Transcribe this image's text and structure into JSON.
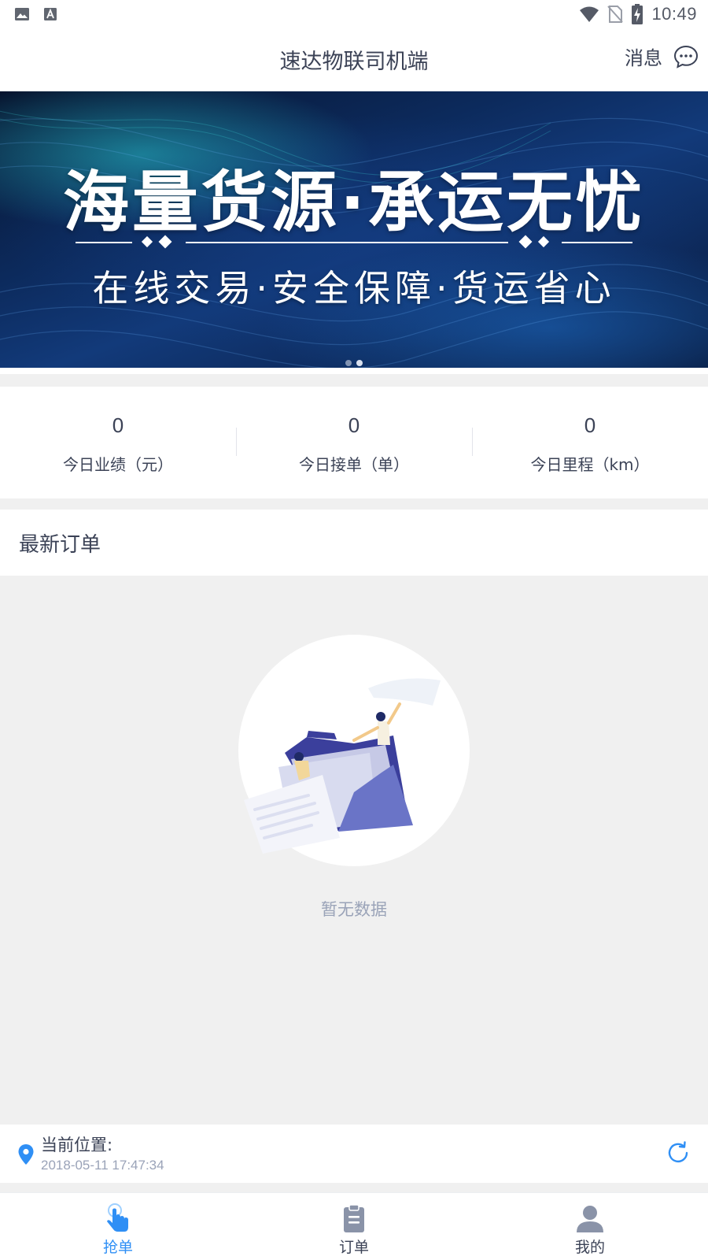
{
  "status_bar": {
    "time": "10:49",
    "left_icons": [
      "image-icon",
      "font-icon"
    ],
    "right_icons": [
      "wifi-icon",
      "no-sim-icon",
      "battery-charging-icon"
    ]
  },
  "header": {
    "title": "速达物联司机端",
    "message_label": "消息",
    "message_icon": "chat-bubble-icon"
  },
  "banner": {
    "headline": "海量货源·承运无忧",
    "subline": "在线交易·安全保障·货运省心",
    "active_slide": 1,
    "slide_count": 2
  },
  "stats": [
    {
      "value": "0",
      "label": "今日业绩（元）"
    },
    {
      "value": "0",
      "label": "今日接单（单）"
    },
    {
      "value": "0",
      "label": "今日里程（km）"
    }
  ],
  "orders": {
    "title": "最新订单",
    "empty_text": "暂无数据"
  },
  "location": {
    "label": "当前位置:",
    "timestamp": "2018-05-11 17:47:34",
    "icon": "location-pin-icon",
    "refresh_icon": "refresh-icon"
  },
  "bottom_nav": {
    "items": [
      {
        "label": "抢单",
        "icon": "tap-hand-icon",
        "active": true
      },
      {
        "label": "订单",
        "icon": "clipboard-icon",
        "active": false
      },
      {
        "label": "我的",
        "icon": "user-icon",
        "active": false
      }
    ]
  },
  "colors": {
    "accent": "#2f8ff5",
    "text": "#3b4256",
    "muted": "#9aa3b8",
    "background_gray": "#f0f0f0"
  }
}
